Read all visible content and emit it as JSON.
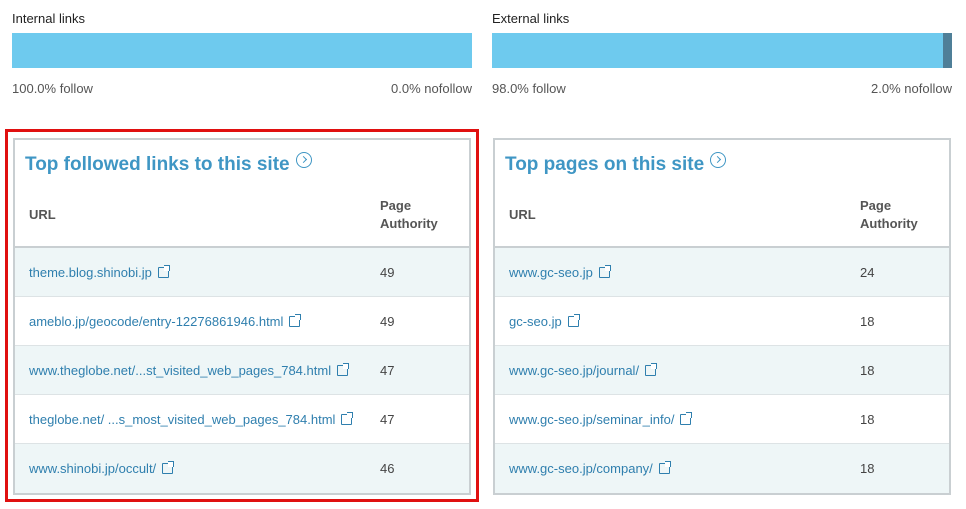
{
  "internal_links": {
    "title": "Internal links",
    "follow_fraction": 1.0,
    "follow_label": "100.0% follow",
    "nofollow_label": "0.0% nofollow",
    "colors": {
      "follow": "#6ecaee",
      "nofollow": "#4f7f98"
    }
  },
  "external_links": {
    "title": "External links",
    "follow_fraction": 0.98,
    "follow_label": "98.0% follow",
    "nofollow_label": "2.0% nofollow",
    "colors": {
      "follow": "#6ecaee",
      "nofollow": "#4f7f98"
    }
  },
  "top_followed": {
    "title": "Top followed links to this site",
    "col_url": "URL",
    "col_pa": "Page Authority",
    "rows": [
      {
        "url": "theme.blog.shinobi.jp",
        "pa": "49"
      },
      {
        "url": "ameblo.jp/geocode/entry-12276861946.html",
        "pa": "49"
      },
      {
        "url": "www.theglobe.net/...st_visited_web_pages_784.html",
        "pa": "47"
      },
      {
        "url": "theglobe.net/ ...s_most_visited_web_pages_784.html",
        "pa": "47"
      },
      {
        "url": "www.shinobi.jp/occult/",
        "pa": "46"
      }
    ]
  },
  "top_pages": {
    "title": "Top pages on this site",
    "col_url": "URL",
    "col_pa": "Page Authority",
    "rows": [
      {
        "url": "www.gc-seo.jp",
        "pa": "24"
      },
      {
        "url": "gc-seo.jp",
        "pa": "18"
      },
      {
        "url": "www.gc-seo.jp/journal/",
        "pa": "18"
      },
      {
        "url": "www.gc-seo.jp/seminar_info/",
        "pa": "18"
      },
      {
        "url": "www.gc-seo.jp/company/",
        "pa": "18"
      }
    ]
  },
  "accent_color": "#3f96c4",
  "highlight_color": "#e01010"
}
